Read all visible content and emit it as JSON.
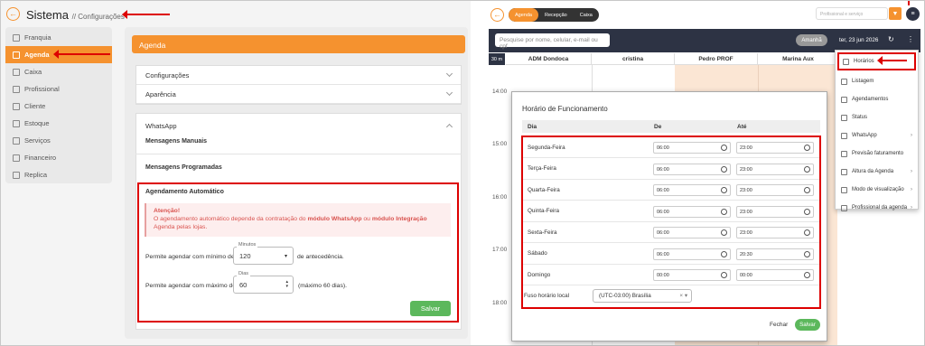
{
  "left": {
    "brand": "Sistema",
    "breadcrumb": "// Configurações",
    "sidebar": [
      {
        "label": "Franquia",
        "active": false
      },
      {
        "label": "Agenda",
        "active": true
      },
      {
        "label": "Caixa",
        "active": false
      },
      {
        "label": "Profissional",
        "active": false
      },
      {
        "label": "Cliente",
        "active": false
      },
      {
        "label": "Estoque",
        "active": false
      },
      {
        "label": "Serviços",
        "active": false
      },
      {
        "label": "Financeiro",
        "active": false
      },
      {
        "label": "Replica",
        "active": false
      }
    ],
    "section_title": "Agenda",
    "acc1": "Configurações",
    "acc2": "Aparência",
    "whatsapp": "WhatsApp",
    "msg_manual": "Mensagens Manuais",
    "msg_prog": "Mensagens Programadas",
    "auto_title": "Agendamento Automático",
    "alert_title": "Atenção!",
    "alert_pre": "O agendamento automático depende da contratação do ",
    "alert_b1": "módulo WhatsApp",
    "alert_mid": " ou ",
    "alert_b2": "módulo Integração",
    "alert_post": " Agenda pelas lojas.",
    "min_label": "Permite agendar com mínimo de",
    "min_float": "Minutos",
    "min_value": "120",
    "min_suffix": "de antecedência.",
    "max_label": "Permite agendar com máximo de",
    "max_float": "Dias",
    "max_value": "60",
    "max_suffix": "(máximo 60 dias).",
    "save": "Salvar"
  },
  "right": {
    "tabs": [
      "Agenda",
      "Recepção",
      "Caixa"
    ],
    "top_search_placeholder": "Profissional e serviço",
    "search_placeholder": "Pesquise por nome, celular, e-mail ou cpf",
    "tomorrow": "Amanhã",
    "date": "ter, 23 jun 2026",
    "interval": "30 m",
    "columns": [
      "ADM Dondoca",
      "cristina",
      "Pedro PROF",
      "Marina Aux"
    ],
    "times": [
      "14:00",
      "15:00",
      "16:00",
      "17:00",
      "18:00"
    ],
    "modal_title": "Horário de Funcionamento",
    "col_day": "Dia",
    "col_from": "De",
    "col_to": "Até",
    "days": [
      {
        "day": "Segunda-Feira",
        "from": "06:00",
        "to": "23:00"
      },
      {
        "day": "Terça-Feira",
        "from": "06:00",
        "to": "23:00"
      },
      {
        "day": "Quarta-Feira",
        "from": "06:00",
        "to": "23:00"
      },
      {
        "day": "Quinta-Feira",
        "from": "06:00",
        "to": "23:00"
      },
      {
        "day": "Sexta-Feira",
        "from": "06:00",
        "to": "23:00"
      },
      {
        "day": "Sábado",
        "from": "06:00",
        "to": "20:30"
      },
      {
        "day": "Domingo",
        "from": "00:00",
        "to": "00:00"
      }
    ],
    "tz_label": "Fuso horário local",
    "tz_value": "(UTC-03:00) Brasília",
    "close": "Fechar",
    "save": "Salvar",
    "menu": [
      {
        "label": "Horários",
        "arrow": false
      },
      {
        "label": "Listagem",
        "arrow": false
      },
      {
        "label": "Agendamentos",
        "arrow": false
      },
      {
        "label": "Status",
        "arrow": false
      },
      {
        "label": "WhatsApp",
        "arrow": true
      },
      {
        "label": "Previsão faturamento",
        "arrow": false
      },
      {
        "label": "Altura da Agenda",
        "arrow": true
      },
      {
        "label": "Modo de visualização",
        "arrow": true
      },
      {
        "label": "Profissional da agenda",
        "arrow": true
      }
    ]
  }
}
